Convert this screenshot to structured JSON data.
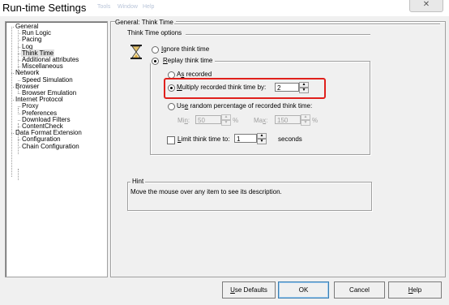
{
  "window": {
    "title": "Run-time Settings",
    "ghost_menu": [
      "Tools",
      "Window",
      "Help"
    ],
    "close_glyph": "✕"
  },
  "tree": {
    "items": [
      {
        "label": "General",
        "level": 0
      },
      {
        "label": "Run Logic",
        "level": 1
      },
      {
        "label": "Pacing",
        "level": 1
      },
      {
        "label": "Log",
        "level": 1
      },
      {
        "label": "Think Time",
        "level": 1,
        "selected": true
      },
      {
        "label": "Additional attributes",
        "level": 1
      },
      {
        "label": "Miscellaneous",
        "level": 1
      },
      {
        "label": "Network",
        "level": 0
      },
      {
        "label": "Speed Simulation",
        "level": 1
      },
      {
        "label": "Browser",
        "level": 0
      },
      {
        "label": "Browser Emulation",
        "level": 1
      },
      {
        "label": "Internet Protocol",
        "level": 0
      },
      {
        "label": "Proxy",
        "level": 1
      },
      {
        "label": "Preferences",
        "level": 1
      },
      {
        "label": "Download Filters",
        "level": 1
      },
      {
        "label": "ContentCheck",
        "level": 1
      },
      {
        "label": "Data Format Extension",
        "level": 0
      },
      {
        "label": "Configuration",
        "level": 1
      },
      {
        "label": "Chain Configuration",
        "level": 1
      }
    ]
  },
  "panel": {
    "header": "General: Think Time",
    "options_group": "Think Time options",
    "icon": "hourglass-icon",
    "ignore_think_time": {
      "prefix": "",
      "hot": "I",
      "rest": "gnore think time",
      "checked": false
    },
    "replay_think_time": {
      "prefix": "",
      "hot": "R",
      "rest": "eplay think time",
      "checked": true
    },
    "as_recorded": {
      "prefix": "A",
      "hot": "s",
      "rest": " recorded",
      "checked": false
    },
    "multiply": {
      "prefix": "",
      "hot": "M",
      "rest": "ultiply recorded think time by:",
      "checked": true,
      "value": "2"
    },
    "random_pct": {
      "prefix": "Us",
      "hot": "e",
      "rest": " random percentage of recorded think time:",
      "checked": false
    },
    "min_label": {
      "prefix": "Mi",
      "hot": "n",
      "rest": ":"
    },
    "min_value": "50",
    "max_label": {
      "prefix": "Ma",
      "hot": "x",
      "rest": ":"
    },
    "max_value": "150",
    "pct_unit": "%",
    "limit": {
      "prefix": "",
      "hot": "L",
      "rest": "imit think time to:",
      "checked": false,
      "value": "1",
      "unit": "seconds"
    },
    "hint_title": "Hint",
    "hint_text": "Move the mouse over any item to see its description."
  },
  "buttons": {
    "use_defaults": {
      "hot": "U",
      "rest": "se Defaults"
    },
    "ok": "OK",
    "cancel": "Cancel",
    "help": {
      "hot": "H",
      "rest": "elp"
    }
  },
  "colors": {
    "highlight": "#e0201c",
    "default_button_border": "#3c7fb1"
  }
}
